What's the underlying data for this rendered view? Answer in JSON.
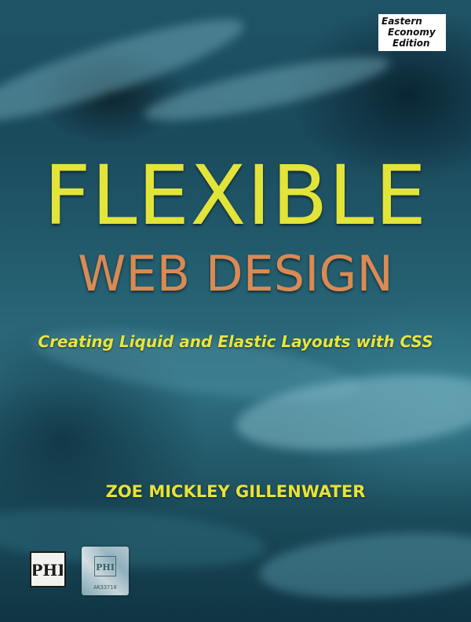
{
  "cover": {
    "edition": [
      "Eastern",
      "Economy",
      "Edition"
    ],
    "title_line_1": "FLEXIBLE",
    "title_line_2": "WEB DESIGN",
    "subtitle": "Creating Liquid and Elastic Layouts with CSS",
    "author": "ZOE MICKLEY GILLENWATER",
    "publisher_logo": "PHI",
    "hologram_code": "PHI",
    "hologram_serial": "AK33710",
    "colors": {
      "title_yellow": "#e3e43a",
      "title_orange": "#d98a55",
      "background_teal": "#1f5467"
    },
    "icons": [
      "publisher-logo",
      "hologram-sticker"
    ]
  }
}
